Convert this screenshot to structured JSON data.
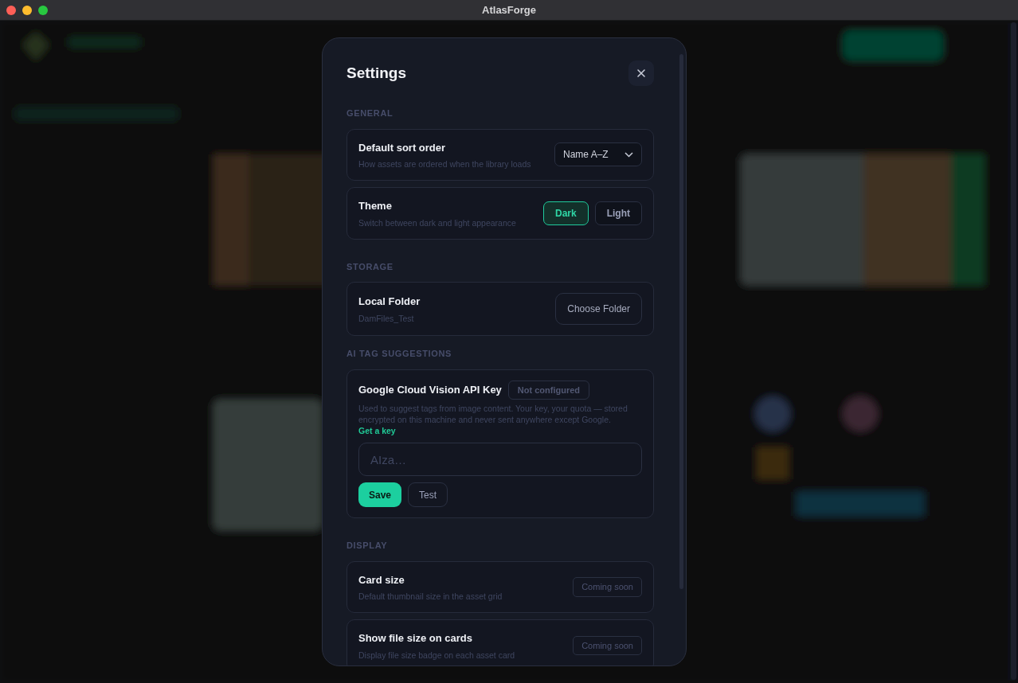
{
  "window": {
    "title": "AtlasForge"
  },
  "dialog": {
    "title": "Settings",
    "sections": [
      {
        "heading": "GENERAL",
        "items": [
          {
            "kind": "select",
            "label": "Default sort order",
            "description": "How assets are ordered when the library loads",
            "value": "Name A–Z"
          },
          {
            "kind": "segmented",
            "label": "Theme",
            "description": "Switch between dark and light appearance",
            "options": [
              {
                "label": "Dark",
                "selected": true
              },
              {
                "label": "Light",
                "selected": false
              }
            ]
          }
        ]
      },
      {
        "heading": "STORAGE",
        "items": [
          {
            "kind": "button",
            "label": "Local Folder",
            "description": "DamFiles_Test",
            "button": "Choose Folder"
          }
        ]
      },
      {
        "heading": "AI TAG SUGGESTIONS",
        "items": [
          {
            "kind": "api_key",
            "label": "Google Cloud Vision API Key",
            "status": "Not configured",
            "description": "Used to suggest tags from image content. Your key, your quota — stored encrypted on this machine and never sent anywhere except Google.",
            "link": "Get a key",
            "placeholder": "AIza…",
            "buttons": [
              {
                "label": "Save",
                "kind": "primary"
              },
              {
                "label": "Test",
                "kind": "outline"
              }
            ]
          }
        ]
      },
      {
        "heading": "DISPLAY",
        "items": [
          {
            "kind": "badge",
            "label": "Card size",
            "description": "Default thumbnail size in the asset grid",
            "badge": "Coming soon"
          },
          {
            "kind": "badge",
            "label": "Show file size on cards",
            "description": "Display file size badge on each asset card",
            "badge": "Coming soon"
          }
        ]
      }
    ]
  }
}
